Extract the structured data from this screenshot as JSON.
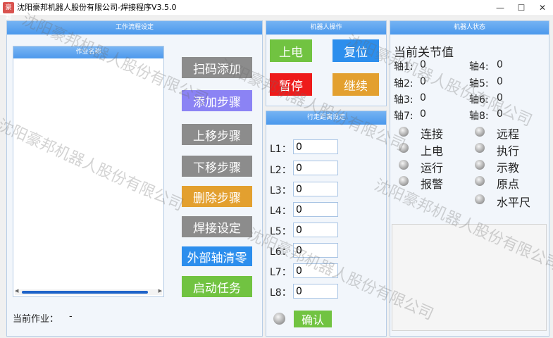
{
  "window": {
    "title": "沈阳豪邦机器人股份有限公司-焊接程序V3.5.0",
    "app_icon": "豪邦",
    "minimize": "—",
    "maximize": "☐",
    "close": "✕"
  },
  "workflow_panel": {
    "title": "工作流程设定",
    "list_header": "作业名称",
    "buttons": {
      "scan_add": "扫码添加",
      "add_step": "添加步骤",
      "move_up": "上移步骤",
      "move_down": "下移步骤",
      "delete_step": "删除步骤",
      "weld_settings": "焊接设定",
      "external_axis_zero": "外部轴清零",
      "start_task": "启动任务"
    },
    "current_job_label": "当前作业：",
    "current_job_value": "-"
  },
  "robot_ops_panel": {
    "title": "机器人操作",
    "buttons": {
      "power_on": "上电",
      "reset": "复位",
      "pause": "暂停",
      "resume": "继续"
    }
  },
  "travel_panel": {
    "title": "行走距离设定",
    "fields": [
      {
        "label": "L1：",
        "value": "0"
      },
      {
        "label": "L2：",
        "value": "0"
      },
      {
        "label": "L3：",
        "value": "0"
      },
      {
        "label": "L4：",
        "value": "0"
      },
      {
        "label": "L5：",
        "value": "0"
      },
      {
        "label": "L6：",
        "value": "0"
      },
      {
        "label": "L7：",
        "value": "0"
      },
      {
        "label": "L8：",
        "value": "0"
      }
    ],
    "confirm": "确认"
  },
  "status_panel": {
    "title": "机器人状态",
    "joints_title": "当前关节值",
    "axes": [
      {
        "label": "轴1:",
        "value": "0"
      },
      {
        "label": "轴2:",
        "value": "0"
      },
      {
        "label": "轴3:",
        "value": "0"
      },
      {
        "label": "轴7:",
        "value": "0"
      },
      {
        "label": "轴4:",
        "value": "0"
      },
      {
        "label": "轴5:",
        "value": "0"
      },
      {
        "label": "轴6:",
        "value": "0"
      },
      {
        "label": "轴8:",
        "value": "0"
      }
    ],
    "indicators": [
      "连接",
      "上电",
      "运行",
      "报警",
      "远程",
      "执行",
      "示教",
      "原点",
      "水平尺"
    ]
  },
  "watermark": "沈阳豪邦机器人股份有限公司",
  "colors": {
    "gray_button": "#8c8c8c",
    "purple_button": "#8b83f4",
    "orange_button": "#e3a02f",
    "blue_button": "#2c8eed",
    "green_button": "#71c341",
    "red_button": "#ee1b1b",
    "panel_header": "#5aa3ef"
  }
}
